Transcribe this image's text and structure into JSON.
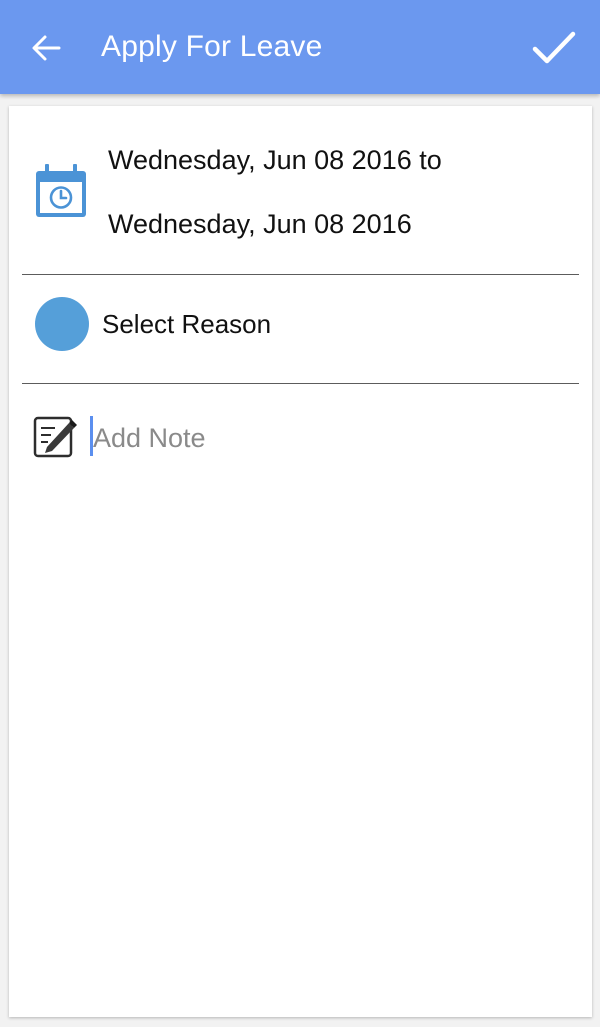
{
  "theme": {
    "accent": "#6b98ef",
    "reason_color": "#559fd9",
    "icon_blue": "#4b93d6"
  },
  "app_bar": {
    "title": "Apply For Leave",
    "back_icon": "arrow-back-icon",
    "confirm_icon": "checkmark-icon"
  },
  "form": {
    "date_range": {
      "icon": "calendar-clock-icon",
      "from": "Wednesday, Jun 08 2016 to",
      "to": "Wednesday, Jun 08 2016"
    },
    "reason": {
      "icon": "circle-icon",
      "label": "Select Reason"
    },
    "note": {
      "icon": "edit-note-icon",
      "placeholder": "Add Note",
      "value": ""
    }
  }
}
